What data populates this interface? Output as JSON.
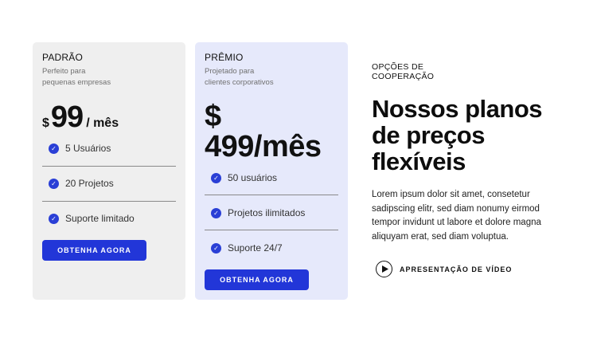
{
  "plans": {
    "basic": {
      "name": "PADRÃO",
      "description_line1": "Perfeito para",
      "description_line2": "pequenas empresas",
      "currency": "$",
      "amount": "99",
      "period": "/ mês",
      "features": [
        "5 Usuários",
        "20 Projetos",
        "Suporte limitado"
      ],
      "cta": "OBTENHA AGORA"
    },
    "premium": {
      "name": "PRÊMIO",
      "description_line1": "Projetado para",
      "description_line2": "clientes corporativos",
      "price_line1": "$",
      "price_line2": "499/mês",
      "features": [
        "50 usuários",
        "Projetos ilimitados",
        "Suporte 24/7"
      ],
      "cta": "OBTENHA AGORA"
    }
  },
  "info": {
    "eyebrow_line1": "OPÇÕES DE",
    "eyebrow_line2": "COOPERAÇÃO",
    "headline_line1": "Nossos planos",
    "headline_line2": "de preços",
    "headline_line3": "flexíveis",
    "body": "Lorem ipsum dolor sit amet, consetetur sadipscing elitr, sed diam nonumy eirmod tempor invidunt ut labore et dolore magna aliquyam erat, sed diam voluptua.",
    "video_label": "APRESENTAÇÃO DE VÍDEO"
  },
  "icons": {
    "feature": "check-circle-icon",
    "video": "play-circle-icon"
  },
  "colors": {
    "accent": "#2236d8",
    "basic_card_bg": "#efefef",
    "premium_card_bg": "#e6e9fb"
  }
}
